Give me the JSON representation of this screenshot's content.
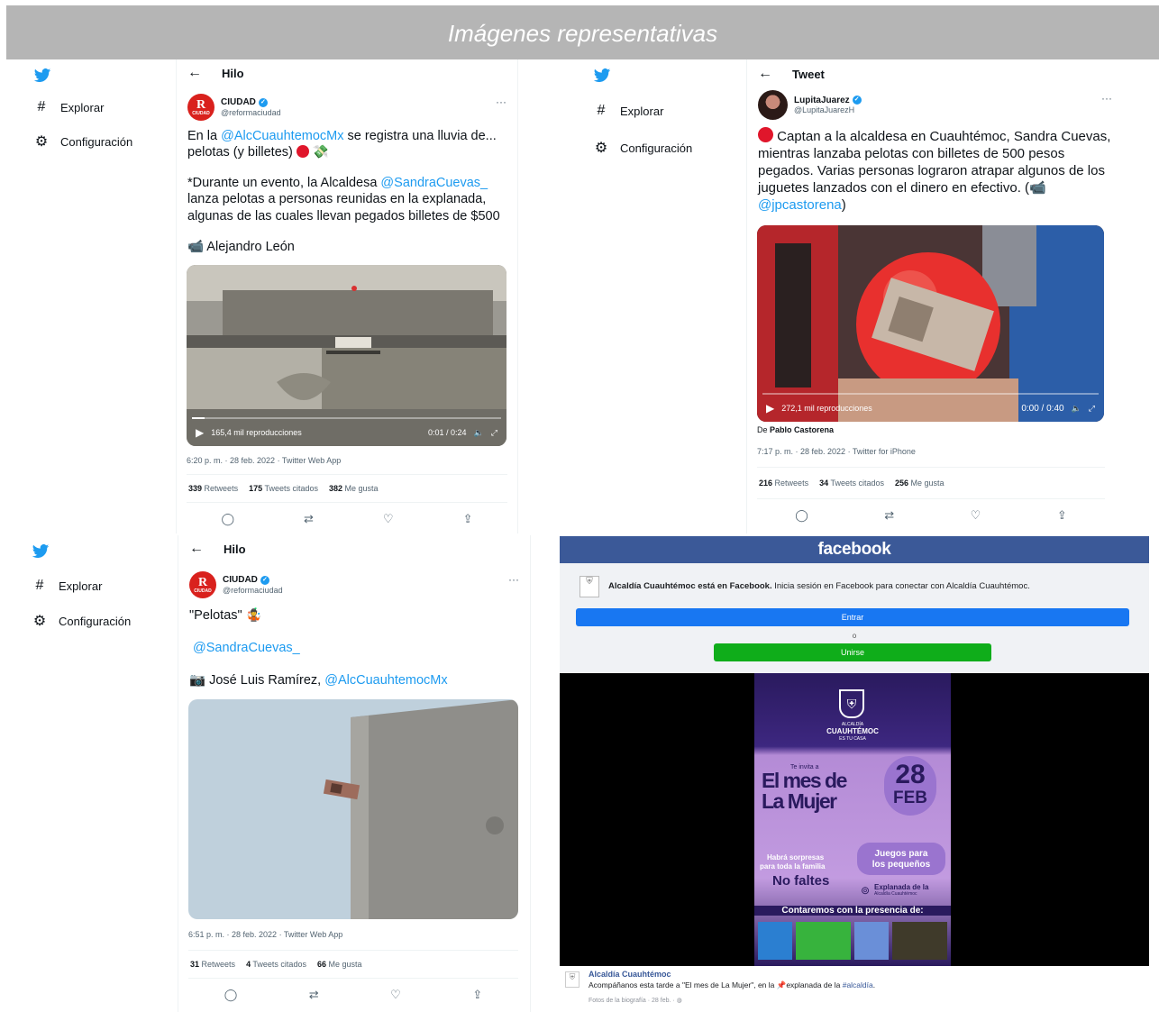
{
  "banner": {
    "title": "Imágenes representativas"
  },
  "sidebar": {
    "explore_label": "Explorar",
    "settings_label": "Configuración"
  },
  "tweet1": {
    "header": "Hilo",
    "author_name": "CIUDAD",
    "author_handle": "@reformaciudad",
    "avatar_letter": "R",
    "avatar_sub": "CIUDAD",
    "text_a": "En la ",
    "mention_a": "@AlcCuauhtemocMx",
    "text_b": " se registra una lluvia de... pelotas (y billetes) ",
    "text_c": "*Durante un evento, la Alcaldesa ",
    "mention_b": "@SandraCuevas_",
    "text_d": " lanza pelotas a personas reunidas en la explanada, algunas de las cuales llevan pegados billetes de $500",
    "credit": "Alejandro León",
    "views": "165,4 mil reproducciones",
    "time": "0:01 / 0:24",
    "progress": 0.04,
    "meta": "6:20 p. m. · 28 feb. 2022 · Twitter Web App",
    "retweets": "339",
    "retweets_label": "Retweets",
    "quotes": "175",
    "quotes_label": "Tweets citados",
    "likes": "382",
    "likes_label": "Me gusta"
  },
  "tweet2": {
    "header": "Tweet",
    "author_name": "LupitaJuarez",
    "author_handle": "@LupitaJuarezH",
    "text_a": " Captan a la alcaldesa en Cuauhtémoc, Sandra Cuevas, mientras lanzaba pelotas con billetes de 500 pesos pegados. Varias personas lograron atrapar algunos de los juguetes lanzados con el dinero en efectivo. (",
    "mention_a": "@jpcastorena",
    "text_b": ")",
    "views": "272,1 mil reproducciones",
    "time": "0:00 / 0:40",
    "progress": 0.0,
    "credit_prefix": "De ",
    "credit": "Pablo Castorena",
    "meta": "7:17 p. m. · 28 feb. 2022 · Twitter for iPhone",
    "retweets": "216",
    "retweets_label": "Retweets",
    "quotes": "34",
    "quotes_label": "Tweets citados",
    "likes": "256",
    "likes_label": "Me gusta"
  },
  "tweet3": {
    "header": "Hilo",
    "author_name": "CIUDAD",
    "author_handle": "@reformaciudad",
    "avatar_letter": "R",
    "avatar_sub": "CIUDAD",
    "text_a": "\"Pelotas\"",
    "mention_a": "@SandraCuevas_",
    "credit": "José Luis Ramírez, ",
    "credit_mention": "@AlcCuauhtemocMx",
    "meta": "6:51 p. m. · 28 feb. 2022 · Twitter Web App",
    "retweets": "31",
    "retweets_label": "Retweets",
    "quotes": "4",
    "quotes_label": "Tweets citados",
    "likes": "66",
    "likes_label": "Me gusta"
  },
  "facebook": {
    "brand": "facebook",
    "msg_bold": "Alcaldía Cuauhtémoc está en Facebook.",
    "msg_rest": " Inicia sesión en Facebook para conectar con Alcaldía Cuauhtémoc.",
    "login_label": "Entrar",
    "or_label": "o",
    "signup_label": "Unirse",
    "poster": {
      "org": "ALCALDÍA",
      "org_name": "CUAUHTÉMOC",
      "org_tag": "ES TU CASA",
      "invite": "Te invita a",
      "title_line1": "El mes de",
      "title_line2": "La Mujer",
      "day": "28",
      "month": "FEB",
      "surprises_1": "Habrá sorpresas",
      "surprises_2": "para toda la familia",
      "dont_miss": "No faltes",
      "games_1": "Juegos para",
      "games_2": "los pequeños",
      "place_1": "Explanada de la",
      "place_2": "Alcaldía Cuauhtémoc",
      "presence": "Contaremos con la presencia de:"
    },
    "page_name": "Alcaldía Cuauhtémoc",
    "post_a": "Acompáñanos esta tarde a \"El mes de La Mujer\", en la ",
    "post_b": "explanada de la ",
    "post_tag": "#alcaldía",
    "post_c": ".",
    "post_meta": "Fotos de la biografía · 28 feb. · "
  },
  "colors": {
    "twitter_blue": "#1d9bf0",
    "facebook_blue": "#3b5998",
    "login_button": "#1877f2",
    "signup_button": "#0fad1a",
    "reforma_red": "#d9211d"
  }
}
